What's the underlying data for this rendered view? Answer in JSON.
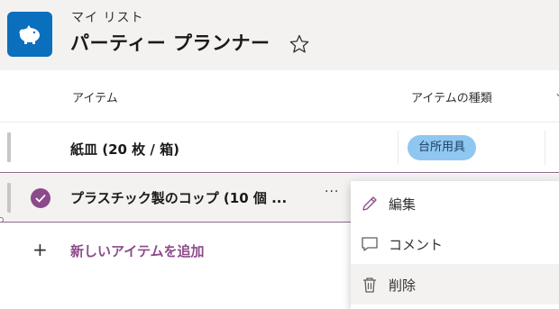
{
  "header": {
    "breadcrumb": "マイ リスト",
    "title": "パーティー プランナー",
    "app_icon": "piggy-bank-icon",
    "favorite_icon": "star-outline-icon"
  },
  "columns": [
    {
      "label": "アイテム"
    },
    {
      "label": "アイテムの種類"
    }
  ],
  "rows": [
    {
      "name": "紙皿 (20 枚 / 箱)",
      "type": "台所用具",
      "selected": false
    },
    {
      "name": "プラスチック製のコップ (10 個 ...",
      "selected": true,
      "more_label": "···"
    }
  ],
  "add_item": {
    "icon": "plus-icon",
    "label": "新しいアイテムを追加"
  },
  "context_menu": {
    "items": [
      {
        "label": "編集",
        "icon": "pencil-icon"
      },
      {
        "label": "コメント",
        "icon": "comment-icon"
      },
      {
        "label": "削除",
        "icon": "trash-icon"
      }
    ]
  },
  "colors": {
    "accent": "#8c4a8a",
    "header_bg": "#f3f2f1",
    "app_icon_bg": "#0a6fbd",
    "pill_bg": "#8fc7f0"
  }
}
